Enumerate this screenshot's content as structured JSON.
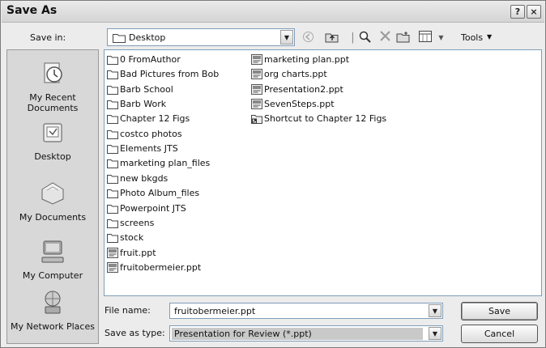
{
  "window": {
    "title": "Save As",
    "help": "?",
    "close": "×"
  },
  "savein": {
    "label": "Save in:",
    "value": "Desktop"
  },
  "toolbar": {
    "tools_label": "Tools"
  },
  "places": [
    {
      "label": "My Recent Documents",
      "icon": "recent-documents-icon"
    },
    {
      "label": "Desktop",
      "icon": "desktop-icon"
    },
    {
      "label": "My Documents",
      "icon": "my-documents-icon"
    },
    {
      "label": "My Computer",
      "icon": "my-computer-icon"
    },
    {
      "label": "My Network Places",
      "icon": "network-places-icon"
    }
  ],
  "files_col1": [
    {
      "name": "0 FromAuthor",
      "kind": "folder"
    },
    {
      "name": "Bad Pictures from Bob",
      "kind": "folder"
    },
    {
      "name": "Barb School",
      "kind": "folder"
    },
    {
      "name": "Barb Work",
      "kind": "folder"
    },
    {
      "name": "Chapter 12 Figs",
      "kind": "folder"
    },
    {
      "name": "costco photos",
      "kind": "folder"
    },
    {
      "name": "Elements JTS",
      "kind": "folder"
    },
    {
      "name": "marketing plan_files",
      "kind": "folder"
    },
    {
      "name": "new bkgds",
      "kind": "folder"
    },
    {
      "name": "Photo Album_files",
      "kind": "folder"
    },
    {
      "name": "Powerpoint JTS",
      "kind": "folder"
    },
    {
      "name": "screens",
      "kind": "folder"
    },
    {
      "name": "stock",
      "kind": "folder"
    },
    {
      "name": "fruit.ppt",
      "kind": "ppt"
    },
    {
      "name": "fruitobermeier.ppt",
      "kind": "ppt"
    }
  ],
  "files_col2": [
    {
      "name": "marketing plan.ppt",
      "kind": "ppt"
    },
    {
      "name": "org charts.ppt",
      "kind": "ppt"
    },
    {
      "name": "Presentation2.ppt",
      "kind": "ppt"
    },
    {
      "name": "SevenSteps.ppt",
      "kind": "ppt"
    },
    {
      "name": "Shortcut to Chapter 12 Figs",
      "kind": "shortcut"
    }
  ],
  "filename": {
    "label": "File name:",
    "value": "fruitobermeier.ppt"
  },
  "savetype": {
    "label": "Save as type:",
    "value": "Presentation for Review (*.ppt)"
  },
  "buttons": {
    "save": "Save",
    "cancel": "Cancel"
  }
}
